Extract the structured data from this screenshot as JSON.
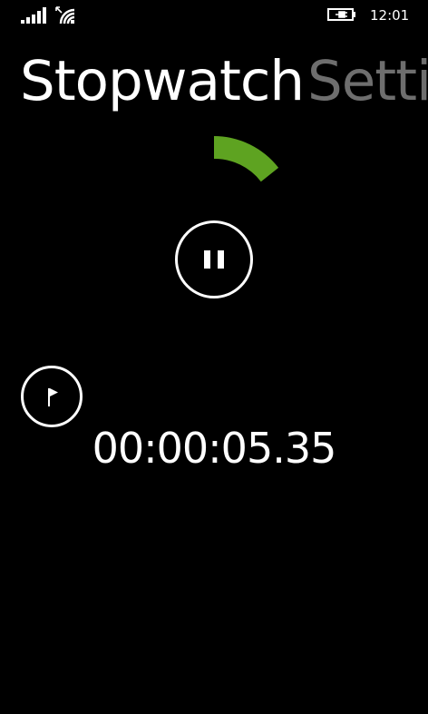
{
  "status_bar": {
    "signal_icon": "signal-strength-icon",
    "wifi_icon": "wifi-icon",
    "battery_icon": "battery-charging-icon",
    "time": "12:01"
  },
  "pivot": {
    "active_title": "Stopwatch",
    "next_title": "Settin"
  },
  "stopwatch": {
    "elapsed": "00:00:05.35",
    "progress_color": "#5ea321",
    "pause_icon": "pause-icon",
    "lap_icon": "flag-icon"
  }
}
